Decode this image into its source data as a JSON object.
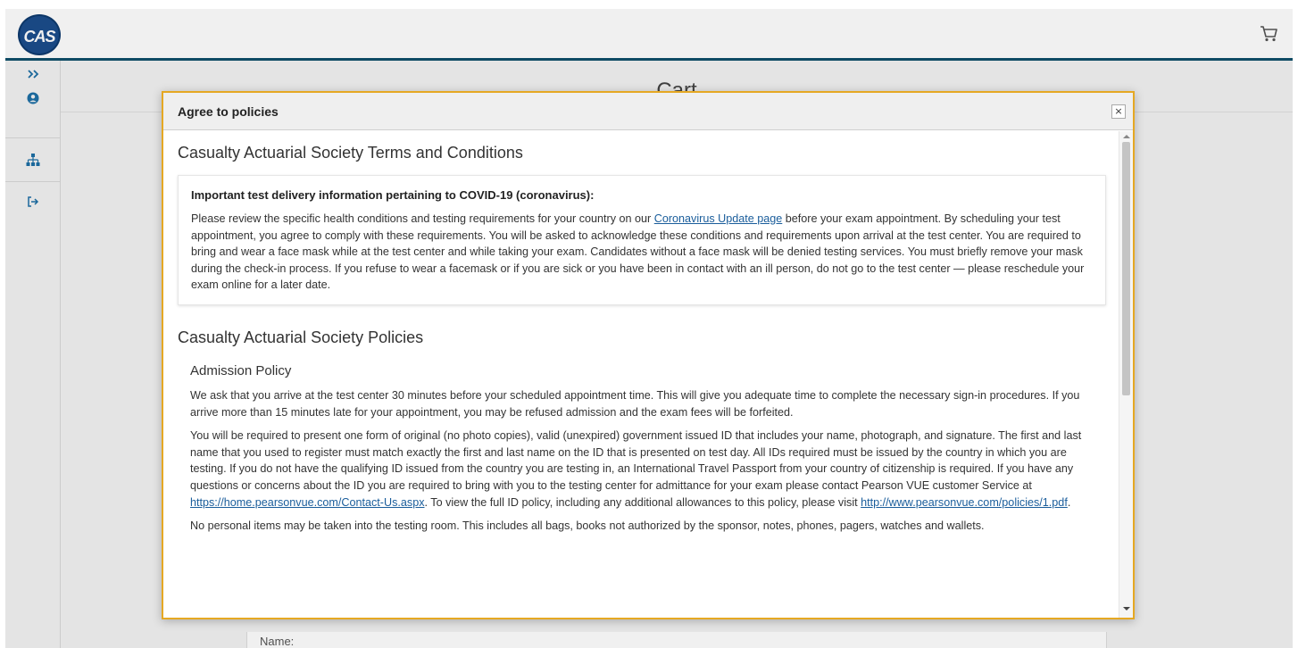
{
  "app": {
    "logo_text": "CAS",
    "page_title": "Cart",
    "bg_name_label": "Name:"
  },
  "modal": {
    "title": "Agree to policies",
    "close_glyph": "×"
  },
  "terms": {
    "heading": "Casualty Actuarial Society Terms and Conditions",
    "notice_title": "Important test delivery information pertaining to COVID-19 (coronavirus):",
    "notice_before_link": "Please review the specific health conditions and testing requirements for your country on our ",
    "notice_link": "Coronavirus Update page",
    "notice_after_link": " before your exam appointment. By scheduling your test appointment, you agree to comply with these requirements. You will be asked to acknowledge these conditions and requirements upon arrival at the test center. You are required to bring and wear a face mask while at the test center and while taking your exam. Candidates without a face mask will be denied testing services. You must briefly remove your mask during the check-in process. If you refuse to wear a facemask or if you are sick or you have been in contact with an ill person, do not go to the test center — please reschedule your exam online for a later date."
  },
  "policies": {
    "heading": "Casualty Actuarial Society Policies",
    "admission_heading": "Admission Policy",
    "p1": "We ask that you arrive at the test center 30 minutes before your scheduled appointment time. This will give you adequate time to complete the necessary sign-in procedures. If you arrive more than 15 minutes late for your appointment, you may be refused admission and the exam fees will be forfeited.",
    "p2_before_link1": "You will be required to present one form of original (no photo copies), valid (unexpired) government issued ID that includes your name, photograph, and signature. The first and last name that you used to register must match exactly the first and last name on the ID that is presented on test day. All IDs required must be issued by the country in which you are testing. If you do not have the qualifying ID issued from the country you are testing in, an International Travel Passport from your country of citizenship is required. If you have any questions or concerns about the ID you are required to bring with you to the testing center for admittance for your exam please contact Pearson VUE customer Service at ",
    "p2_link1": "https://home.pearsonvue.com/Contact-Us.aspx",
    "p2_between": ". To view the full ID policy, including any additional allowances to this policy, please visit ",
    "p2_link2": "http://www.pearsonvue.com/policies/1.pdf",
    "p2_end": ".",
    "p3": "No personal items may be taken into the testing room. This includes all bags, books not authorized by the sponsor, notes, phones, pagers, watches and wallets."
  },
  "icons": {
    "expand": "chevrons-right-icon",
    "user": "user-circle-icon",
    "sitemap": "sitemap-icon",
    "logout": "sign-out-icon",
    "cart": "cart-icon"
  },
  "colors": {
    "accent": "#1d6fa5",
    "modal_border": "#e5a823",
    "topbar_border": "#0f4f6b",
    "link": "#1a5d9b"
  }
}
